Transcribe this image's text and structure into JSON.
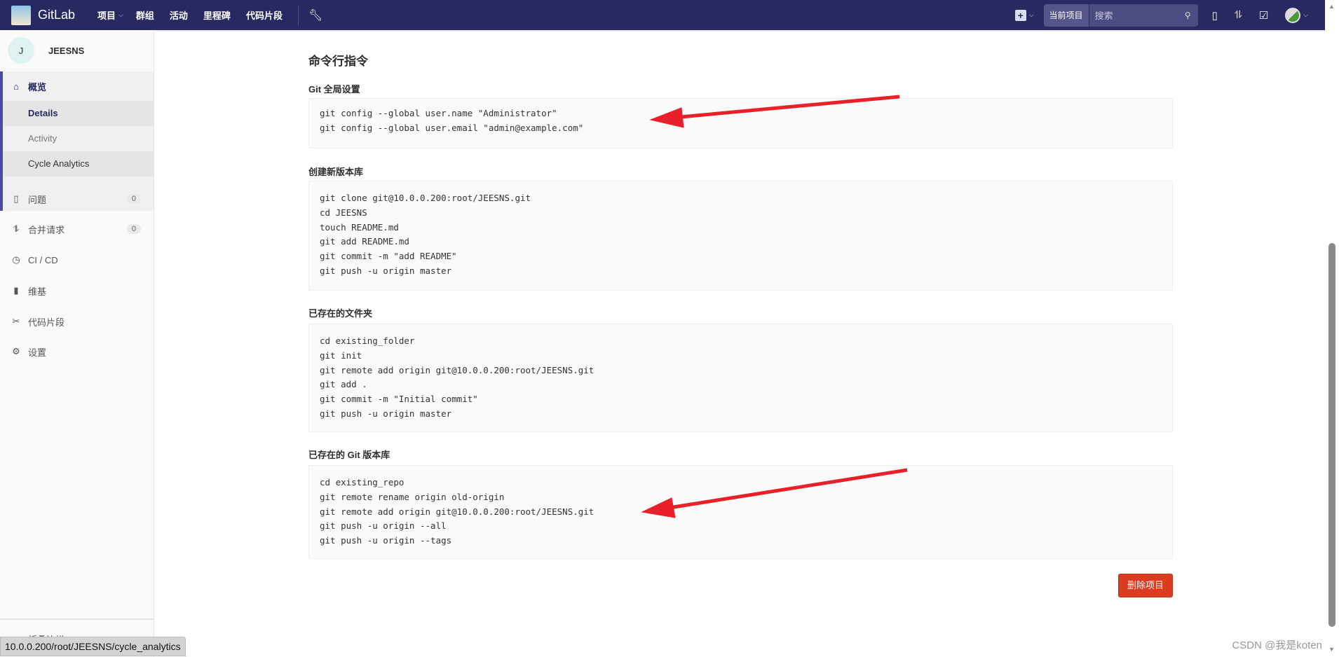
{
  "nav": {
    "brand": "GitLab",
    "links": [
      "项目",
      "群组",
      "活动",
      "里程碑",
      "代码片段"
    ],
    "search_scope": "当前项目",
    "search_placeholder": "搜索"
  },
  "sidebar": {
    "project_initial": "J",
    "project_name": "JEESNS",
    "overview": "概览",
    "sub": [
      "Details",
      "Activity",
      "Cycle Analytics"
    ],
    "items": [
      {
        "label": "问题",
        "count": "0"
      },
      {
        "label": "合并请求",
        "count": "0"
      },
      {
        "label": "CI / CD"
      },
      {
        "label": "维基"
      },
      {
        "label": "代码片段"
      },
      {
        "label": "设置"
      }
    ],
    "collapse": "折叠边栏"
  },
  "main": {
    "title": "命令行指令",
    "sections": [
      {
        "label": "Git 全局设置",
        "code": "git config --global user.name \"Administrator\"\ngit config --global user.email \"admin@example.com\""
      },
      {
        "label": "创建新版本库",
        "code": "git clone git@10.0.0.200:root/JEESNS.git\ncd JEESNS\ntouch README.md\ngit add README.md\ngit commit -m \"add README\"\ngit push -u origin master"
      },
      {
        "label": "已存在的文件夹",
        "code": "cd existing_folder\ngit init\ngit remote add origin git@10.0.0.200:root/JEESNS.git\ngit add .\ngit commit -m \"Initial commit\"\ngit push -u origin master"
      },
      {
        "label": "已存在的 Git 版本库",
        "code": "cd existing_repo\ngit remote rename origin old-origin\ngit remote add origin git@10.0.0.200:root/JEESNS.git\ngit push -u origin --all\ngit push -u origin --tags"
      }
    ],
    "delete_label": "删除项目"
  },
  "status_url": "10.0.0.200/root/JEESNS/cycle_analytics",
  "watermark": "CSDN @我是koten",
  "colors": {
    "nav": "#292961",
    "accent": "#4b4ba3",
    "danger": "#db3b21",
    "annotation": "#e8202a"
  }
}
